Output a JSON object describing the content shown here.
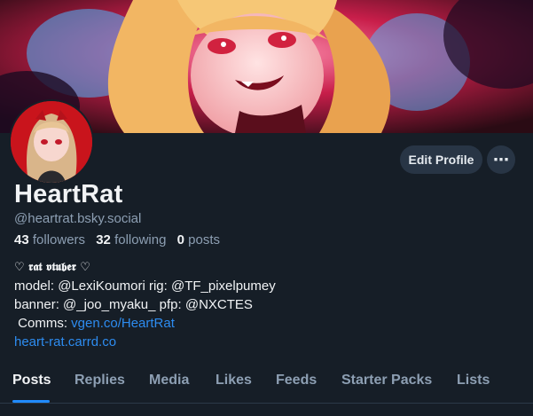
{
  "profile": {
    "display_name": "HeartRat",
    "handle": "@heartrat.bsky.social",
    "followers_count": "43",
    "followers_label": "followers",
    "following_count": "32",
    "following_label": "following",
    "posts_count": "0",
    "posts_label": "posts"
  },
  "actions": {
    "edit_profile": "Edit Profile",
    "more": "⋯"
  },
  "bio": {
    "title": "♡ 𝖗𝖆𝖙 𝖛𝖙𝖚𝖇𝖊𝖗 ♡",
    "line1": "model: @LexiKoumori rig: @TF_pixelpumey",
    "line2": "banner: @_joo_myaku_ pfp: @NXCTES",
    "comms_label": " Comms: ",
    "comms_link": "vgen.co/HeartRat",
    "site_link": "heart-rat.carrd.co"
  },
  "tabs": [
    {
      "label": "Posts"
    },
    {
      "label": "Replies"
    },
    {
      "label": "Media"
    },
    {
      "label": "Likes"
    },
    {
      "label": "Feeds"
    },
    {
      "label": "Starter Packs"
    },
    {
      "label": "Lists"
    }
  ],
  "colors": {
    "background": "#161e27",
    "accent": "#208bfe",
    "link": "#2d8cf0",
    "muted": "#8d9fb3"
  }
}
